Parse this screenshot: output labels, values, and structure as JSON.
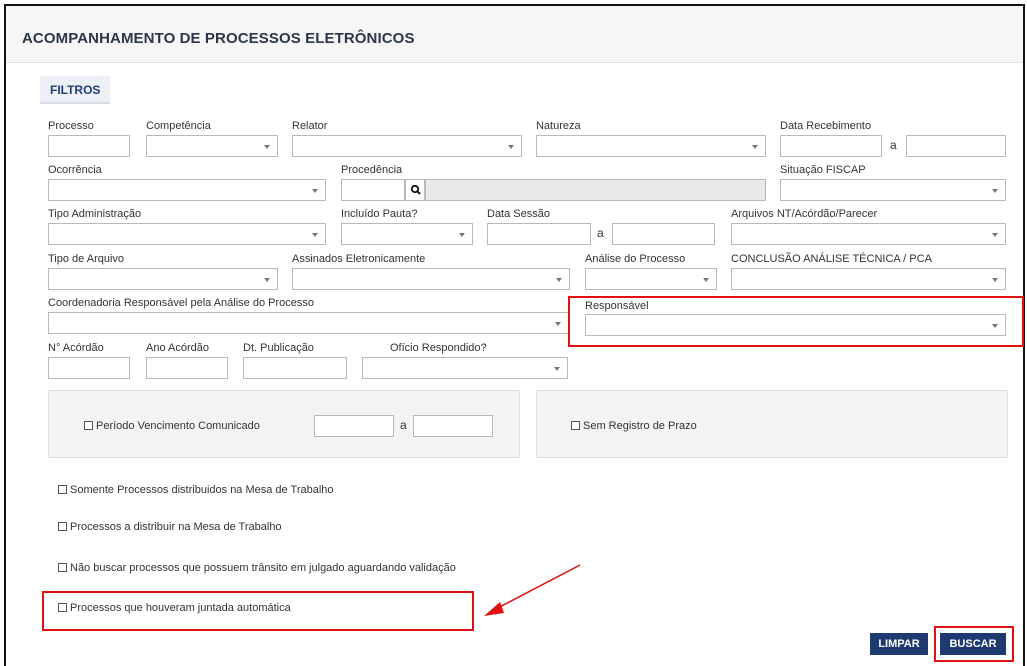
{
  "page": {
    "title": "ACOMPANHAMENTO DE PROCESSOS ELETRÔNICOS"
  },
  "tab": {
    "label": "FILTROS"
  },
  "labels": {
    "processo": "Processo",
    "competencia": "Competência",
    "relator": "Relator",
    "natureza": "Natureza",
    "data_recebimento": "Data Recebimento",
    "ocorrencia": "Ocorrência",
    "procedencia": "Procedência",
    "situacao_fiscap": "Situação FISCAP",
    "tipo_administracao": "Tipo Administração",
    "incluido_pauta": "Incluído Pauta?",
    "data_sessao": "Data Sessão",
    "arquivos": "Arquivos NT/Acórdão/Parecer",
    "tipo_arquivo": "Tipo de Arquivo",
    "assinados": "Assinados Eletronicamente",
    "analise_processo": "Análise do Processo",
    "conclusao": "CONCLUSÃO ANÁLISE TÉCNICA / PCA",
    "coordenadoria": "Coordenadoria Responsável pela Análise do Processo",
    "responsavel": "Responsável",
    "n_acordao": "N° Acórdão",
    "ano_acordao": "Ano Acórdão",
    "dt_publicacao": "Dt. Publicação",
    "oficio_respondido": "Ofício Respondido?"
  },
  "range_sep": "a",
  "checkboxes": {
    "periodo_vencimento": "Período Vencimento Comunicado",
    "sem_registro_prazo": "Sem Registro de Prazo",
    "somente_mesa": "Somente Processos distribuidos na Mesa de Trabalho",
    "a_distribuir": "Processos a distribuir na Mesa de Trabalho",
    "nao_buscar_transito": "Não buscar processos que possuem trânsito em julgado aguardando validação",
    "juntada_automatica": "Processos que houveram juntada automática"
  },
  "buttons": {
    "limpar": "LIMPAR",
    "buscar": "BUSCAR"
  },
  "icons": {
    "search": "magnifier-icon",
    "dropdown": "chevron-down-icon"
  },
  "colors": {
    "accent": "#1f3a6e",
    "highlight": "#e01010"
  }
}
